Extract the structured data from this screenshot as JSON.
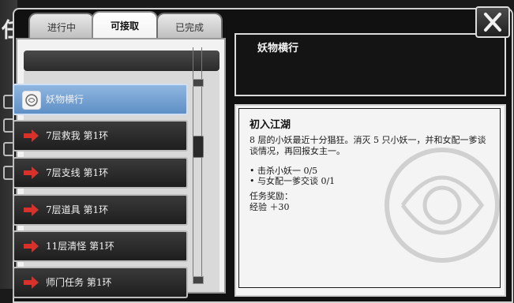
{
  "tabs": [
    {
      "label": "进行中",
      "active": false
    },
    {
      "label": "可接取",
      "active": true
    },
    {
      "label": "已完成",
      "active": false
    }
  ],
  "quest_list": [
    {
      "label": "妖物横行",
      "selected": true,
      "icon": "scroll-icon"
    },
    {
      "label": "7层救我 第1环",
      "selected": false,
      "icon": "red-arrow-icon"
    },
    {
      "label": "7层支线 第1环",
      "selected": false,
      "icon": "red-arrow-icon"
    },
    {
      "label": "7层道具 第1环",
      "selected": false,
      "icon": "red-arrow-icon"
    },
    {
      "label": "11层清怪 第1环",
      "selected": false,
      "icon": "red-arrow-icon"
    },
    {
      "label": "师门任务 第1环",
      "selected": false,
      "icon": "red-arrow-icon"
    }
  ],
  "detail": {
    "header": "妖物横行",
    "title": "初入江湖",
    "description": "8 层的小妖最近十分猖狂。消灭 5 只小妖一，并和女配一爹谈谈情况，再回报女主一。",
    "objectives": [
      "• 击杀小妖一 0/5",
      "• 与女配一爹交谈 0/1"
    ],
    "reward_label": "任务奖励：",
    "reward_value": "经验 ＋30"
  },
  "colors": {
    "selected": "#6f9fd3",
    "accent_red": "#d9302a"
  }
}
